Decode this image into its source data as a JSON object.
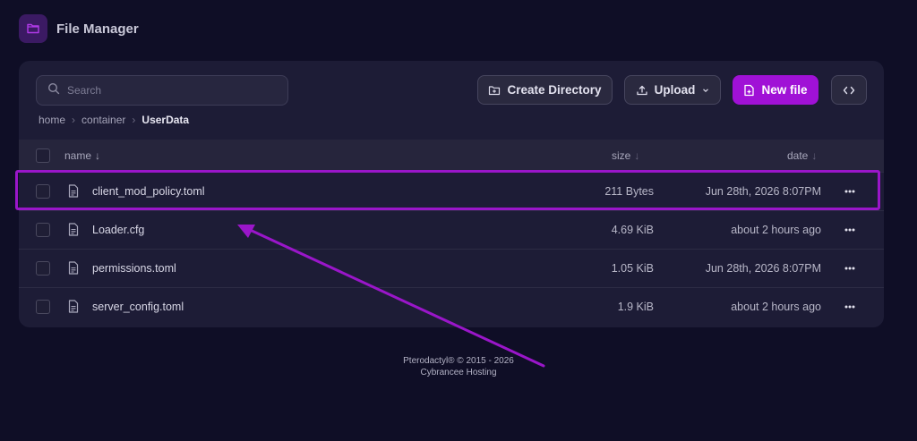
{
  "app": {
    "title": "File Manager"
  },
  "toolbar": {
    "search_placeholder": "Search",
    "create_directory": "Create Directory",
    "upload": "Upload",
    "new_file": "New file"
  },
  "breadcrumb": {
    "items": [
      "home",
      "container"
    ],
    "current": "UserData"
  },
  "table": {
    "columns": {
      "name": "name",
      "size": "size",
      "date": "date",
      "sort_arrow": "↓"
    },
    "rows": [
      {
        "name": "client_mod_policy.toml",
        "size": "211 Bytes",
        "date": "Jun 28th, 2026 8:07PM"
      },
      {
        "name": "Loader.cfg",
        "size": "4.69 KiB",
        "date": "about 2 hours ago"
      },
      {
        "name": "permissions.toml",
        "size": "1.05 KiB",
        "date": "Jun 28th, 2026 8:07PM"
      },
      {
        "name": "server_config.toml",
        "size": "1.9 KiB",
        "date": "about 2 hours ago"
      }
    ]
  },
  "footer": {
    "line1": "Pterodactyl® © 2015 - 2026",
    "line2": "Cybrancee Hosting"
  },
  "colors": {
    "accent": "#a011d6",
    "highlight": "#9a16c9",
    "background": "#0f0e26",
    "panel": "#1d1c36"
  },
  "icons": [
    "folder-icon",
    "search-icon",
    "folder-plus-icon",
    "upload-icon",
    "chevron-down-icon",
    "file-plus-icon",
    "code-icon",
    "file-text-icon",
    "more-horizontal-icon",
    "chevron-right-icon"
  ]
}
